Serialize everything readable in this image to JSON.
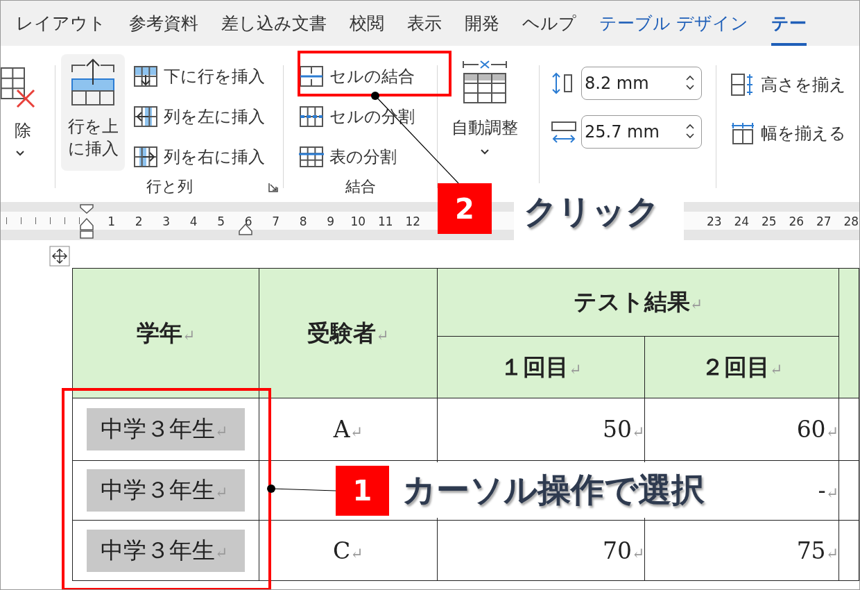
{
  "tabs": [
    {
      "label": "レイアウト",
      "kind": "standard",
      "selected": false
    },
    {
      "label": "参考資料",
      "kind": "standard",
      "selected": false
    },
    {
      "label": "差し込み文書",
      "kind": "standard",
      "selected": false
    },
    {
      "label": "校閲",
      "kind": "standard",
      "selected": false
    },
    {
      "label": "表示",
      "kind": "standard",
      "selected": false
    },
    {
      "label": "開発",
      "kind": "standard",
      "selected": false
    },
    {
      "label": "ヘルプ",
      "kind": "standard",
      "selected": false
    },
    {
      "label": "テーブル デザイン",
      "kind": "contextual",
      "selected": false
    },
    {
      "label": "テー",
      "kind": "contextual",
      "selected": true
    }
  ],
  "ribbon": {
    "delete_button": {
      "label": "除"
    },
    "insert_above_button": {
      "label": "行を上に挿入"
    },
    "rows_columns_commands": [
      "下に行を挿入",
      "列を左に挿入",
      "列を右に挿入"
    ],
    "rows_columns_group": "行と列",
    "merge_commands": [
      "セルの結合",
      "セルの分割",
      "表の分割"
    ],
    "merge_group": "結合",
    "autofit_button": {
      "label": "自動調整"
    },
    "height_field": {
      "value": "8.2 mm"
    },
    "width_field": {
      "value": "25.7 mm"
    },
    "distribute_commands": [
      "高さを揃え",
      "幅を揃える"
    ]
  },
  "ruler": {
    "segments": [
      [
        "1",
        "2",
        "3",
        "4",
        "5",
        "6",
        "7",
        "8",
        "9",
        "10",
        "11",
        "12"
      ],
      [
        "23",
        "24",
        "25",
        "26",
        "27",
        "28"
      ]
    ]
  },
  "table": {
    "header_1": [
      {
        "text": "学年",
        "mark": "↵"
      },
      {
        "text": "受験者",
        "mark": "↵"
      },
      {
        "text": "テスト結果",
        "mark": "↵"
      }
    ],
    "header_2": [
      {
        "text": "１回目",
        "mark": "↵"
      },
      {
        "text": "２回目",
        "mark": "↵"
      }
    ],
    "rows": [
      [
        {
          "text": "中学３年生",
          "mark": "↵",
          "selected": true
        },
        {
          "text": "A",
          "mark": "↵",
          "selected": false
        },
        {
          "text": "50",
          "mark": "↵",
          "selected": false
        },
        {
          "text": "60",
          "mark": "↵",
          "selected": false
        }
      ],
      [
        {
          "text": "中学３年生",
          "mark": "↵",
          "selected": true
        },
        null,
        null,
        {
          "text": "-",
          "mark": "↵",
          "selected": false
        }
      ],
      [
        {
          "text": "中学３年生",
          "mark": "↵",
          "selected": true
        },
        {
          "text": "C",
          "mark": "↵",
          "selected": false
        },
        {
          "text": "70",
          "mark": "↵",
          "selected": false
        },
        {
          "text": "75",
          "mark": "↵",
          "selected": false
        }
      ]
    ]
  },
  "callouts": [
    {
      "number": "2",
      "text": "クリック"
    },
    {
      "number": "1",
      "text": "カーソル操作で選択"
    }
  ]
}
